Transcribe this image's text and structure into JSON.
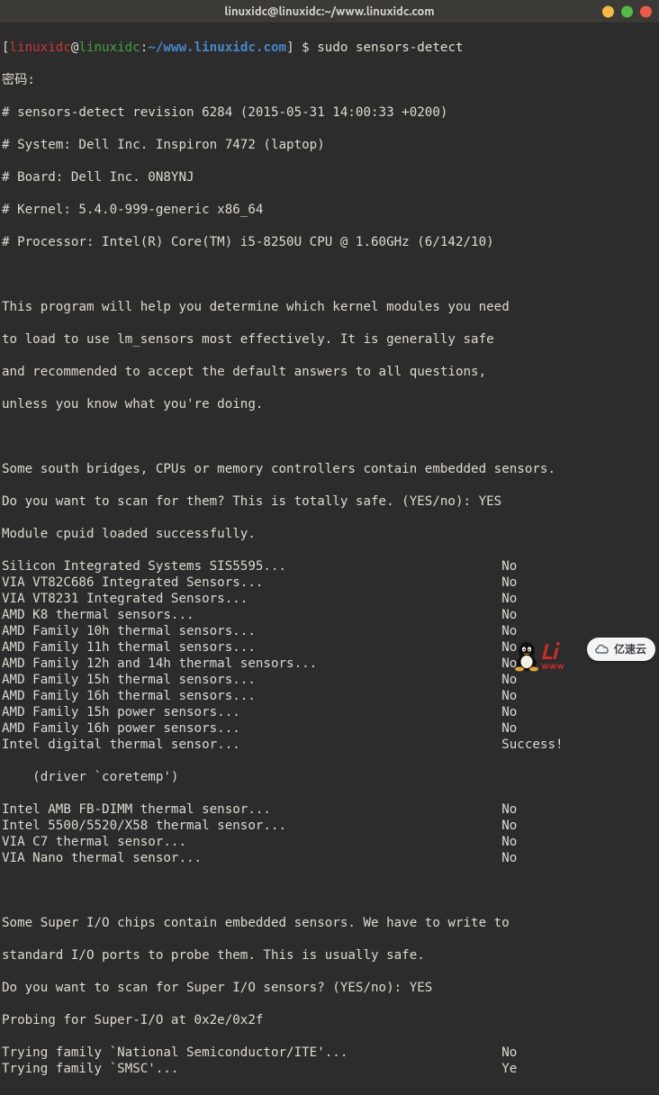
{
  "title": "linuxidc@linuxidc:~/www.linuxidc.com",
  "prompt": {
    "open": "[",
    "user": "linuxidc",
    "at": "@",
    "host": "linuxidc",
    "sep": ":",
    "path": "~/www.linuxidc.com",
    "close": "] $ ",
    "cmd": "sudo sensors-detect"
  },
  "pwd_label": "密码:",
  "header": [
    "# sensors-detect revision 6284 (2015-05-31 14:00:33 +0200)",
    "# System: Dell Inc. Inspiron 7472 (laptop)",
    "# Board: Dell Inc. 0N8YNJ",
    "# Kernel: 5.4.0-999-generic x86_64",
    "# Processor: Intel(R) Core(TM) i5-8250U CPU @ 1.60GHz (6/142/10)"
  ],
  "intro": [
    "This program will help you determine which kernel modules you need",
    "to load to use lm_sensors most effectively. It is generally safe",
    "and recommended to accept the default answers to all questions,",
    "unless you know what you're doing."
  ],
  "scan1": {
    "p1": "Some south bridges, CPUs or memory controllers contain embedded sensors.",
    "prompt": "Do you want to scan for them? This is totally safe. (YES/no): ",
    "answer": "YES",
    "loaded": "Module cpuid loaded successfully."
  },
  "results1": [
    {
      "label": "Silicon Integrated Systems SIS5595... ",
      "pad": 27,
      "value": "No"
    },
    {
      "label": "VIA VT82C686 Integrated Sensors... ",
      "pad": 30,
      "value": "No"
    },
    {
      "label": "VIA VT8231 Integrated Sensors... ",
      "pad": 32,
      "value": "No"
    },
    {
      "label": "AMD K8 thermal sensors... ",
      "pad": 39,
      "value": "No"
    },
    {
      "label": "AMD Family 10h thermal sensors... ",
      "pad": 31,
      "value": "No"
    },
    {
      "label": "AMD Family 11h thermal sensors... ",
      "pad": 31,
      "value": "No"
    },
    {
      "label": "AMD Family 12h and 14h thermal sensors... ",
      "pad": 23,
      "value": "No"
    },
    {
      "label": "AMD Family 15h thermal sensors... ",
      "pad": 31,
      "value": "No"
    },
    {
      "label": "AMD Family 16h thermal sensors... ",
      "pad": 31,
      "value": "No"
    },
    {
      "label": "AMD Family 15h power sensors... ",
      "pad": 33,
      "value": "No"
    },
    {
      "label": "AMD Family 16h power sensors... ",
      "pad": 33,
      "value": "No"
    },
    {
      "label": "Intel digital thermal sensor... ",
      "pad": 33,
      "value": "Success!"
    }
  ],
  "driver_note": "    (driver `coretemp')",
  "results2": [
    {
      "label": "Intel AMB FB-DIMM thermal sensor... ",
      "pad": 29,
      "value": "No"
    },
    {
      "label": "Intel 5500/5520/X58 thermal sensor... ",
      "pad": 27,
      "value": "No"
    },
    {
      "label": "VIA C7 thermal sensor... ",
      "pad": 40,
      "value": "No"
    },
    {
      "label": "VIA Nano thermal sensor... ",
      "pad": 38,
      "value": "No"
    }
  ],
  "scan2": {
    "p1": "Some Super I/O chips contain embedded sensors. We have to write to",
    "p2": "standard I/O ports to probe them. This is usually safe.",
    "prompt": "Do you want to scan for Super I/O sensors? (YES/no): ",
    "answer": "YES",
    "probing": "Probing for Super-I/O at 0x2e/0x2f"
  },
  "results3": [
    {
      "label": "Trying family `National Semiconductor/ITE'... ",
      "pad": 19,
      "value": "No"
    },
    {
      "label": "Trying family `SMSC'... ",
      "pad": 41,
      "value": "Ye"
    }
  ],
  "wm1": {
    "top": "Li",
    "bot": "www"
  },
  "wm2": {
    "text": "亿速云"
  }
}
